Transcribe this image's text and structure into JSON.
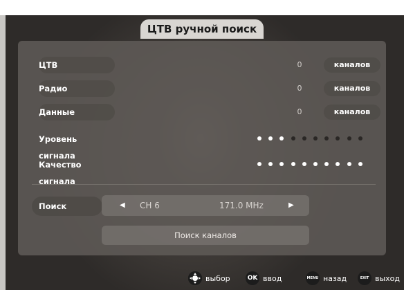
{
  "title": "ЦТВ ручной поиск",
  "rows": [
    {
      "label": "ЦТВ",
      "count": "0",
      "unit": "каналов"
    },
    {
      "label": "Радио",
      "count": "0",
      "unit": "каналов"
    },
    {
      "label": "Данные",
      "count": "0",
      "unit": "каналов"
    }
  ],
  "signal_level": {
    "label": "Уровень сигнала",
    "level": 3,
    "total": 10
  },
  "signal_quality": {
    "label": "Качество сигнала",
    "level": 10,
    "total": 10
  },
  "search": {
    "label": "Поиск",
    "channel": "CH 6",
    "frequency": "171.0 MHz",
    "scan_button": "Поиск каналов"
  },
  "footer": [
    {
      "icon": "dpad-icon",
      "icon_text": "",
      "label": "выбор"
    },
    {
      "icon": "ok-icon",
      "icon_text": "OK",
      "label": "ввод"
    },
    {
      "icon": "menu-icon",
      "icon_text": "MENU",
      "label": "назад"
    },
    {
      "icon": "exit-icon",
      "icon_text": "EXIT",
      "label": "выход"
    }
  ]
}
